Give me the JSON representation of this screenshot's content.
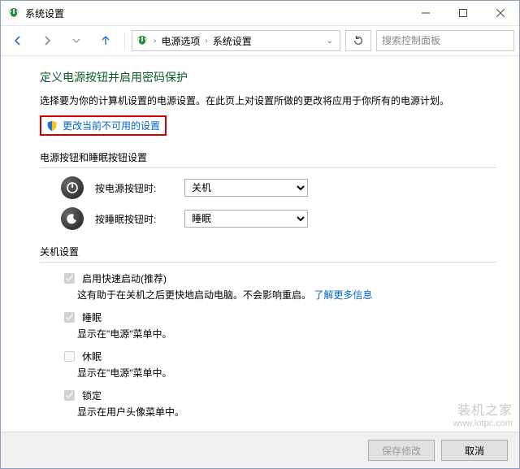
{
  "window": {
    "title": "系统设置"
  },
  "breadcrumb": {
    "item1": "电源选项",
    "item2": "系统设置"
  },
  "search": {
    "placeholder": "搜索控制面板"
  },
  "page": {
    "heading": "定义电源按钮并启用密码保护",
    "description": "选择要为你的计算机设置的电源设置。在此页上对设置所做的更改将应用于你所有的电源计划。",
    "change_link": "更改当前不可用的设置"
  },
  "sections": {
    "buttons_heading": "电源按钮和睡眠按钮设置",
    "shutdown_heading": "关机设置"
  },
  "options": {
    "power_button": {
      "label": "按电源按钮时:",
      "value": "关机"
    },
    "sleep_button": {
      "label": "按睡眠按钮时:",
      "value": "睡眠"
    }
  },
  "checkboxes": {
    "fast_startup": {
      "label": "启用快速启动(推荐)",
      "sub_prefix": "这有助于在关机之后更快地启动电脑。不会影响重启。",
      "sub_link": "了解更多信息"
    },
    "sleep": {
      "label": "睡眠",
      "sub": "显示在\"电源\"菜单中。"
    },
    "hibernate": {
      "label": "休眠",
      "sub": "显示在\"电源\"菜单中。"
    },
    "lock": {
      "label": "锁定",
      "sub": "显示在用户头像菜单中。"
    }
  },
  "footer": {
    "save": "保存修改",
    "cancel": "取消"
  },
  "watermark": {
    "main": "装机之家",
    "url": "www.lotpc.com"
  }
}
